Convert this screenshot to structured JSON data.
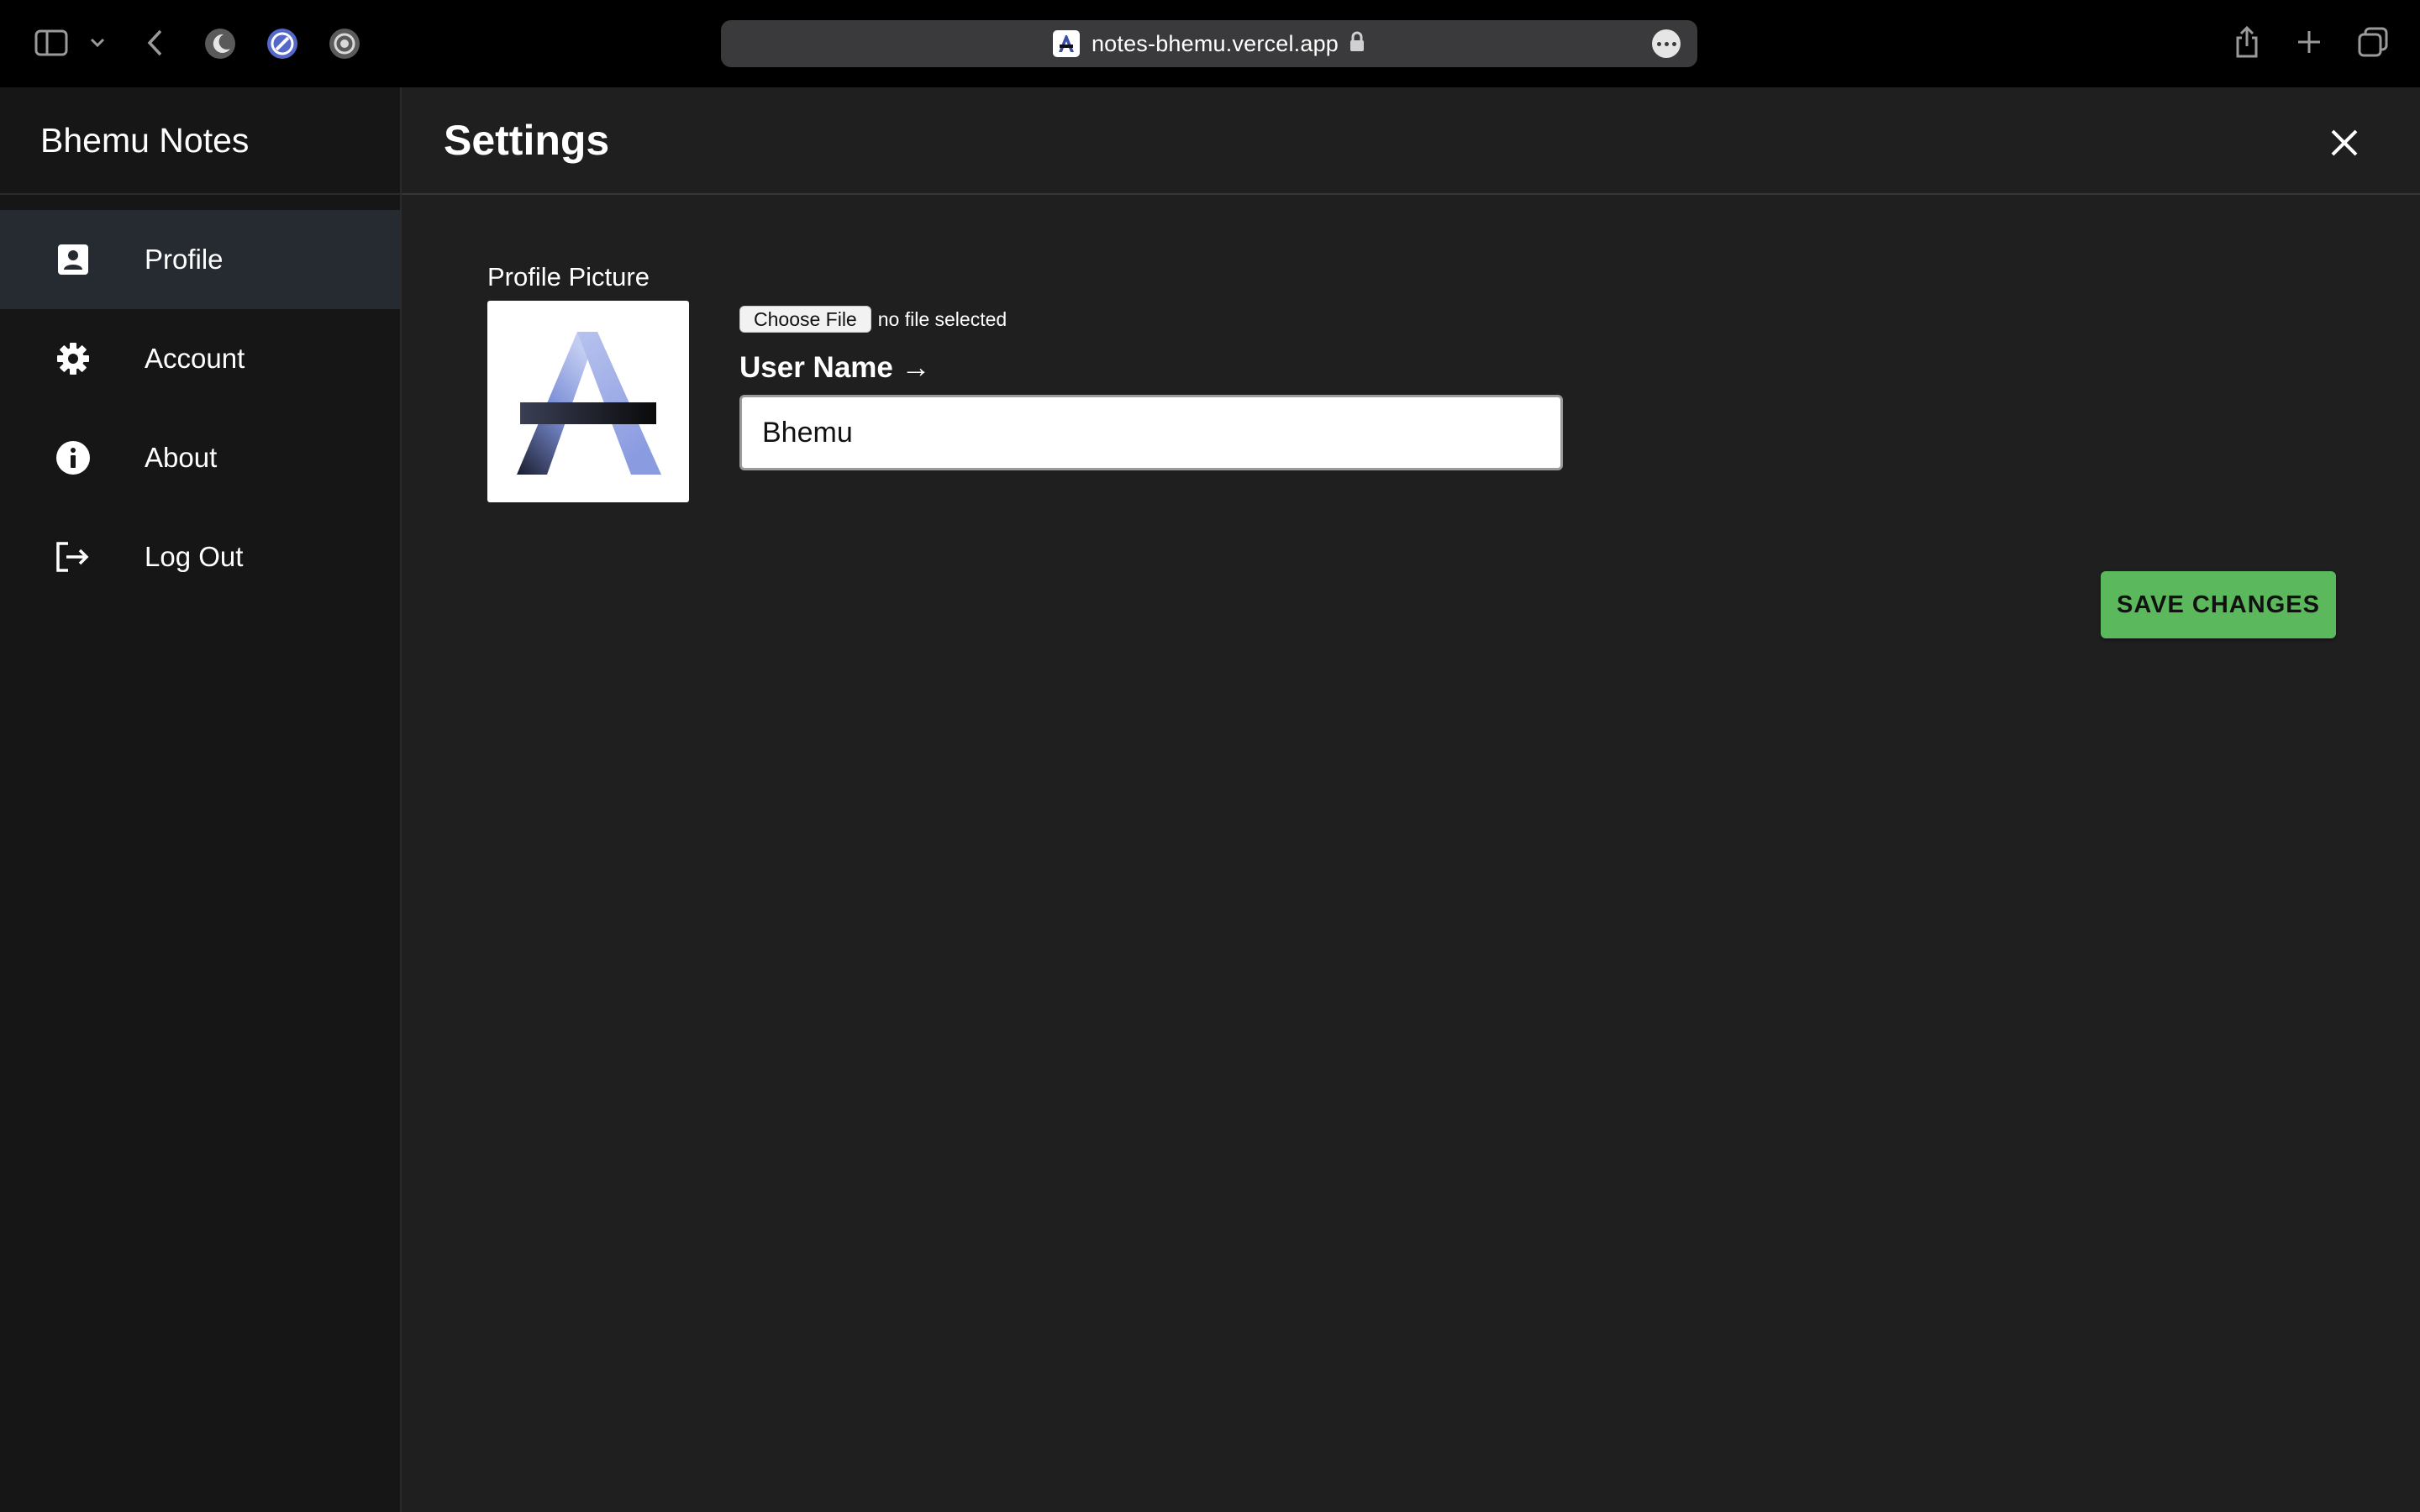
{
  "browser": {
    "url": "notes-bhemu.vercel.app",
    "icons": [
      "sidebar-toggle-icon",
      "chevron-down-icon",
      "back-arrow-icon",
      "dark-mode-extension-icon",
      "compass-extension-icon",
      "record-extension-icon",
      "lock-icon",
      "more-icon",
      "share-icon",
      "new-tab-icon",
      "tab-overview-icon"
    ]
  },
  "sidebar": {
    "app_title": "Bhemu Notes",
    "items": [
      {
        "label": "Profile",
        "icon": "profile-icon",
        "active": true
      },
      {
        "label": "Account",
        "icon": "gear-icon",
        "active": false
      },
      {
        "label": "About",
        "icon": "info-icon",
        "active": false
      },
      {
        "label": "Log Out",
        "icon": "logout-icon",
        "active": false
      }
    ]
  },
  "main": {
    "title": "Settings",
    "close_icon": "close-icon",
    "profile_picture_label": "Profile Picture",
    "choose_file_label": "Choose File",
    "file_status": "no file selected",
    "username_label": "User Name →",
    "username_value": "Bhemu",
    "save_label": "SAVE CHANGES"
  },
  "colors": {
    "background": "#1f1f1f",
    "sidebar_bg": "#161616",
    "active_item_bg": "#262b31",
    "save_button": "#5cb85c",
    "avatar_logo": "#7b8fd6"
  }
}
